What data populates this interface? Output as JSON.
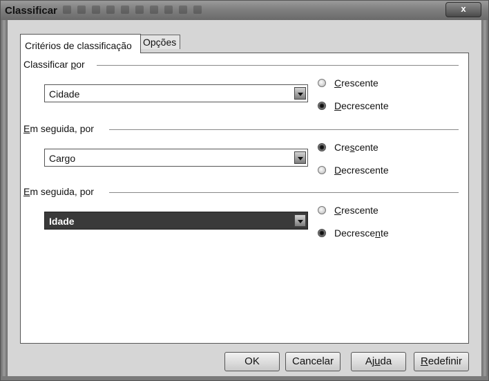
{
  "window": {
    "title": "Classificar",
    "close_label": "x"
  },
  "tabs": [
    {
      "label": "Critérios de classificação",
      "active": true
    },
    {
      "label": "Opções",
      "active": false
    }
  ],
  "groups": [
    {
      "label_pre": "Classificar ",
      "label_key": "p",
      "label_post": "or",
      "field_value": "Cidade",
      "field_selected": false,
      "asc": {
        "pre": "",
        "key": "C",
        "post": "rescente",
        "checked": false
      },
      "desc": {
        "pre": "",
        "key": "D",
        "post": "ecrescente",
        "checked": true
      }
    },
    {
      "label_pre": "",
      "label_key": "E",
      "label_post": "m seguida, por",
      "field_value": "Cargo",
      "field_selected": false,
      "asc": {
        "pre": "Cre",
        "key": "s",
        "post": "cente",
        "checked": true
      },
      "desc": {
        "pre": "",
        "key": "D",
        "post": "ecrescente",
        "checked": false
      }
    },
    {
      "label_pre": "",
      "label_key": "E",
      "label_post": "m seguida, por",
      "field_value": "Idade",
      "field_selected": true,
      "asc": {
        "pre": "",
        "key": "C",
        "post": "rescente",
        "checked": false
      },
      "desc": {
        "pre": "Decresce",
        "key": "n",
        "post": "te",
        "checked": true
      }
    }
  ],
  "buttons": {
    "ok": "OK",
    "cancel": "Cancelar",
    "help_pre": "Aj",
    "help_key": "u",
    "help_post": "da",
    "reset_pre": "",
    "reset_key": "R",
    "reset_post": "edefinir"
  }
}
